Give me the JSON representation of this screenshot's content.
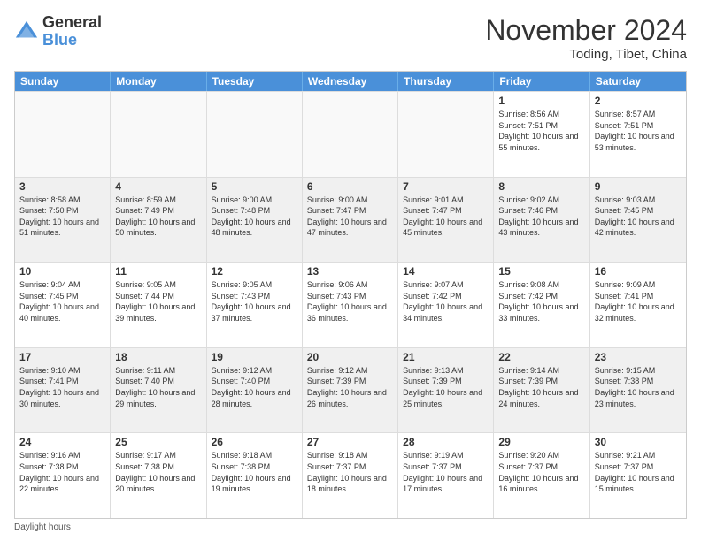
{
  "logo": {
    "general": "General",
    "blue": "Blue"
  },
  "title": "November 2024",
  "location": "Toding, Tibet, China",
  "days_of_week": [
    "Sunday",
    "Monday",
    "Tuesday",
    "Wednesday",
    "Thursday",
    "Friday",
    "Saturday"
  ],
  "footer": "Daylight hours",
  "weeks": [
    [
      {
        "day": "",
        "sunrise": "",
        "sunset": "",
        "daylight": "",
        "empty": true
      },
      {
        "day": "",
        "sunrise": "",
        "sunset": "",
        "daylight": "",
        "empty": true
      },
      {
        "day": "",
        "sunrise": "",
        "sunset": "",
        "daylight": "",
        "empty": true
      },
      {
        "day": "",
        "sunrise": "",
        "sunset": "",
        "daylight": "",
        "empty": true
      },
      {
        "day": "",
        "sunrise": "",
        "sunset": "",
        "daylight": "",
        "empty": true
      },
      {
        "day": "1",
        "sunrise": "Sunrise: 8:56 AM",
        "sunset": "Sunset: 7:51 PM",
        "daylight": "Daylight: 10 hours and 55 minutes.",
        "empty": false
      },
      {
        "day": "2",
        "sunrise": "Sunrise: 8:57 AM",
        "sunset": "Sunset: 7:51 PM",
        "daylight": "Daylight: 10 hours and 53 minutes.",
        "empty": false
      }
    ],
    [
      {
        "day": "3",
        "sunrise": "Sunrise: 8:58 AM",
        "sunset": "Sunset: 7:50 PM",
        "daylight": "Daylight: 10 hours and 51 minutes.",
        "empty": false
      },
      {
        "day": "4",
        "sunrise": "Sunrise: 8:59 AM",
        "sunset": "Sunset: 7:49 PM",
        "daylight": "Daylight: 10 hours and 50 minutes.",
        "empty": false
      },
      {
        "day": "5",
        "sunrise": "Sunrise: 9:00 AM",
        "sunset": "Sunset: 7:48 PM",
        "daylight": "Daylight: 10 hours and 48 minutes.",
        "empty": false
      },
      {
        "day": "6",
        "sunrise": "Sunrise: 9:00 AM",
        "sunset": "Sunset: 7:47 PM",
        "daylight": "Daylight: 10 hours and 47 minutes.",
        "empty": false
      },
      {
        "day": "7",
        "sunrise": "Sunrise: 9:01 AM",
        "sunset": "Sunset: 7:47 PM",
        "daylight": "Daylight: 10 hours and 45 minutes.",
        "empty": false
      },
      {
        "day": "8",
        "sunrise": "Sunrise: 9:02 AM",
        "sunset": "Sunset: 7:46 PM",
        "daylight": "Daylight: 10 hours and 43 minutes.",
        "empty": false
      },
      {
        "day": "9",
        "sunrise": "Sunrise: 9:03 AM",
        "sunset": "Sunset: 7:45 PM",
        "daylight": "Daylight: 10 hours and 42 minutes.",
        "empty": false
      }
    ],
    [
      {
        "day": "10",
        "sunrise": "Sunrise: 9:04 AM",
        "sunset": "Sunset: 7:45 PM",
        "daylight": "Daylight: 10 hours and 40 minutes.",
        "empty": false
      },
      {
        "day": "11",
        "sunrise": "Sunrise: 9:05 AM",
        "sunset": "Sunset: 7:44 PM",
        "daylight": "Daylight: 10 hours and 39 minutes.",
        "empty": false
      },
      {
        "day": "12",
        "sunrise": "Sunrise: 9:05 AM",
        "sunset": "Sunset: 7:43 PM",
        "daylight": "Daylight: 10 hours and 37 minutes.",
        "empty": false
      },
      {
        "day": "13",
        "sunrise": "Sunrise: 9:06 AM",
        "sunset": "Sunset: 7:43 PM",
        "daylight": "Daylight: 10 hours and 36 minutes.",
        "empty": false
      },
      {
        "day": "14",
        "sunrise": "Sunrise: 9:07 AM",
        "sunset": "Sunset: 7:42 PM",
        "daylight": "Daylight: 10 hours and 34 minutes.",
        "empty": false
      },
      {
        "day": "15",
        "sunrise": "Sunrise: 9:08 AM",
        "sunset": "Sunset: 7:42 PM",
        "daylight": "Daylight: 10 hours and 33 minutes.",
        "empty": false
      },
      {
        "day": "16",
        "sunrise": "Sunrise: 9:09 AM",
        "sunset": "Sunset: 7:41 PM",
        "daylight": "Daylight: 10 hours and 32 minutes.",
        "empty": false
      }
    ],
    [
      {
        "day": "17",
        "sunrise": "Sunrise: 9:10 AM",
        "sunset": "Sunset: 7:41 PM",
        "daylight": "Daylight: 10 hours and 30 minutes.",
        "empty": false
      },
      {
        "day": "18",
        "sunrise": "Sunrise: 9:11 AM",
        "sunset": "Sunset: 7:40 PM",
        "daylight": "Daylight: 10 hours and 29 minutes.",
        "empty": false
      },
      {
        "day": "19",
        "sunrise": "Sunrise: 9:12 AM",
        "sunset": "Sunset: 7:40 PM",
        "daylight": "Daylight: 10 hours and 28 minutes.",
        "empty": false
      },
      {
        "day": "20",
        "sunrise": "Sunrise: 9:12 AM",
        "sunset": "Sunset: 7:39 PM",
        "daylight": "Daylight: 10 hours and 26 minutes.",
        "empty": false
      },
      {
        "day": "21",
        "sunrise": "Sunrise: 9:13 AM",
        "sunset": "Sunset: 7:39 PM",
        "daylight": "Daylight: 10 hours and 25 minutes.",
        "empty": false
      },
      {
        "day": "22",
        "sunrise": "Sunrise: 9:14 AM",
        "sunset": "Sunset: 7:39 PM",
        "daylight": "Daylight: 10 hours and 24 minutes.",
        "empty": false
      },
      {
        "day": "23",
        "sunrise": "Sunrise: 9:15 AM",
        "sunset": "Sunset: 7:38 PM",
        "daylight": "Daylight: 10 hours and 23 minutes.",
        "empty": false
      }
    ],
    [
      {
        "day": "24",
        "sunrise": "Sunrise: 9:16 AM",
        "sunset": "Sunset: 7:38 PM",
        "daylight": "Daylight: 10 hours and 22 minutes.",
        "empty": false
      },
      {
        "day": "25",
        "sunrise": "Sunrise: 9:17 AM",
        "sunset": "Sunset: 7:38 PM",
        "daylight": "Daylight: 10 hours and 20 minutes.",
        "empty": false
      },
      {
        "day": "26",
        "sunrise": "Sunrise: 9:18 AM",
        "sunset": "Sunset: 7:38 PM",
        "daylight": "Daylight: 10 hours and 19 minutes.",
        "empty": false
      },
      {
        "day": "27",
        "sunrise": "Sunrise: 9:18 AM",
        "sunset": "Sunset: 7:37 PM",
        "daylight": "Daylight: 10 hours and 18 minutes.",
        "empty": false
      },
      {
        "day": "28",
        "sunrise": "Sunrise: 9:19 AM",
        "sunset": "Sunset: 7:37 PM",
        "daylight": "Daylight: 10 hours and 17 minutes.",
        "empty": false
      },
      {
        "day": "29",
        "sunrise": "Sunrise: 9:20 AM",
        "sunset": "Sunset: 7:37 PM",
        "daylight": "Daylight: 10 hours and 16 minutes.",
        "empty": false
      },
      {
        "day": "30",
        "sunrise": "Sunrise: 9:21 AM",
        "sunset": "Sunset: 7:37 PM",
        "daylight": "Daylight: 10 hours and 15 minutes.",
        "empty": false
      }
    ]
  ]
}
